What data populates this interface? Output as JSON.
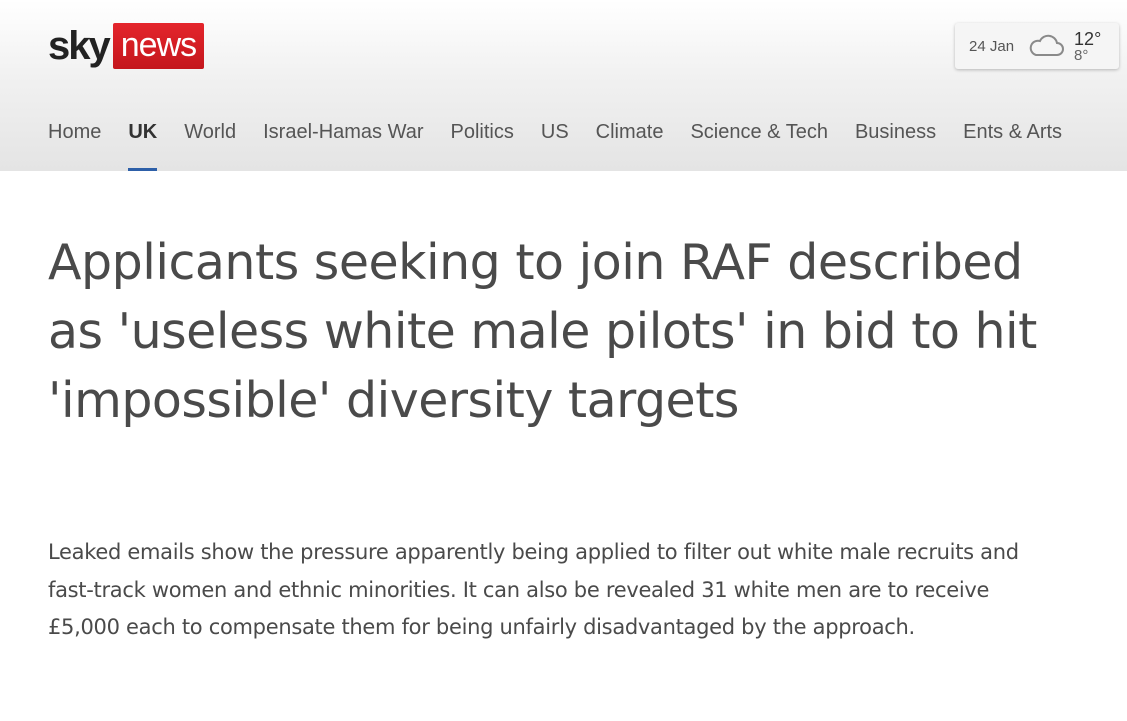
{
  "logo": {
    "sky": "sky",
    "news": "news"
  },
  "weather": {
    "date": "24 Jan",
    "icon": "cloud-icon",
    "high": "12°",
    "low": "8°"
  },
  "nav": {
    "items": [
      {
        "label": "Home",
        "active": false
      },
      {
        "label": "UK",
        "active": true
      },
      {
        "label": "World",
        "active": false
      },
      {
        "label": "Israel-Hamas War",
        "active": false
      },
      {
        "label": "Politics",
        "active": false
      },
      {
        "label": "US",
        "active": false
      },
      {
        "label": "Climate",
        "active": false
      },
      {
        "label": "Science & Tech",
        "active": false
      },
      {
        "label": "Business",
        "active": false
      },
      {
        "label": "Ents & Arts",
        "active": false
      }
    ]
  },
  "article": {
    "headline": "Applicants seeking to join RAF described as 'useless white male pilots' in bid to hit 'impossible' diversity targets",
    "standfirst": "Leaked emails show the pressure apparently being applied to filter out white male recruits and fast-track women and ethnic minorities. It can also be revealed 31 white men are to receive £5,000 each to compensate them for being unfairly disadvantaged by the approach."
  },
  "colors": {
    "brand_red": "#d71920",
    "active_underline": "#2d5fa8",
    "text": "#4a4a4a"
  }
}
